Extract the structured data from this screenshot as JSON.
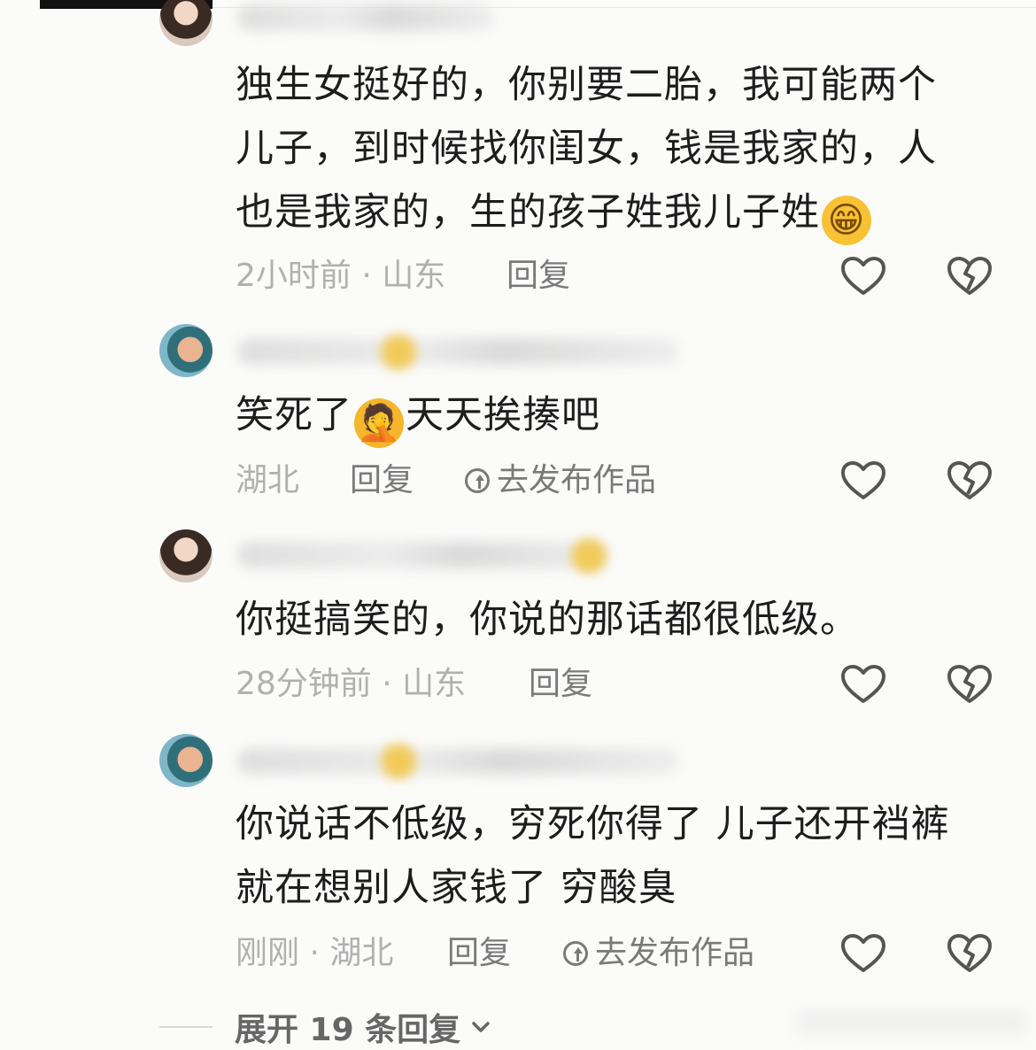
{
  "comments": [
    {
      "content": "独生女挺好的，你别要二胎，我可能两个儿子，到时候找你闺女，钱是我家的，人也是我家的，生的孩子姓我儿子姓",
      "emoji": "😁",
      "meta": "2小时前 · 山东",
      "reply_label": "回复"
    },
    {
      "content_before": "笑死了",
      "emoji": "🤦",
      "content_after": "天天挨揍吧",
      "meta": "湖北",
      "reply_label": "回复",
      "publish_label": "去发布作品"
    },
    {
      "content": "你挺搞笑的，你说的那话都很低级。",
      "meta": "28分钟前 · 山东",
      "reply_label": "回复"
    },
    {
      "content": "你说话不低级，穷死你得了 儿子还开裆裤就在想别人家钱了 穷酸臭",
      "meta": "刚刚 · 湖北",
      "reply_label": "回复",
      "publish_label": "去发布作品"
    }
  ],
  "expand_replies": {
    "label": "展开 19 条回复"
  },
  "icons": {
    "like": "heart-outline-icon",
    "dislike": "broken-heart-icon",
    "publish": "upload-circle-icon",
    "expand": "chevron-down-icon"
  },
  "colors": {
    "background": "#fbfbfa",
    "text": "#1d1d1d",
    "meta": "#b0b0b0",
    "action": "#7a7a7a"
  }
}
